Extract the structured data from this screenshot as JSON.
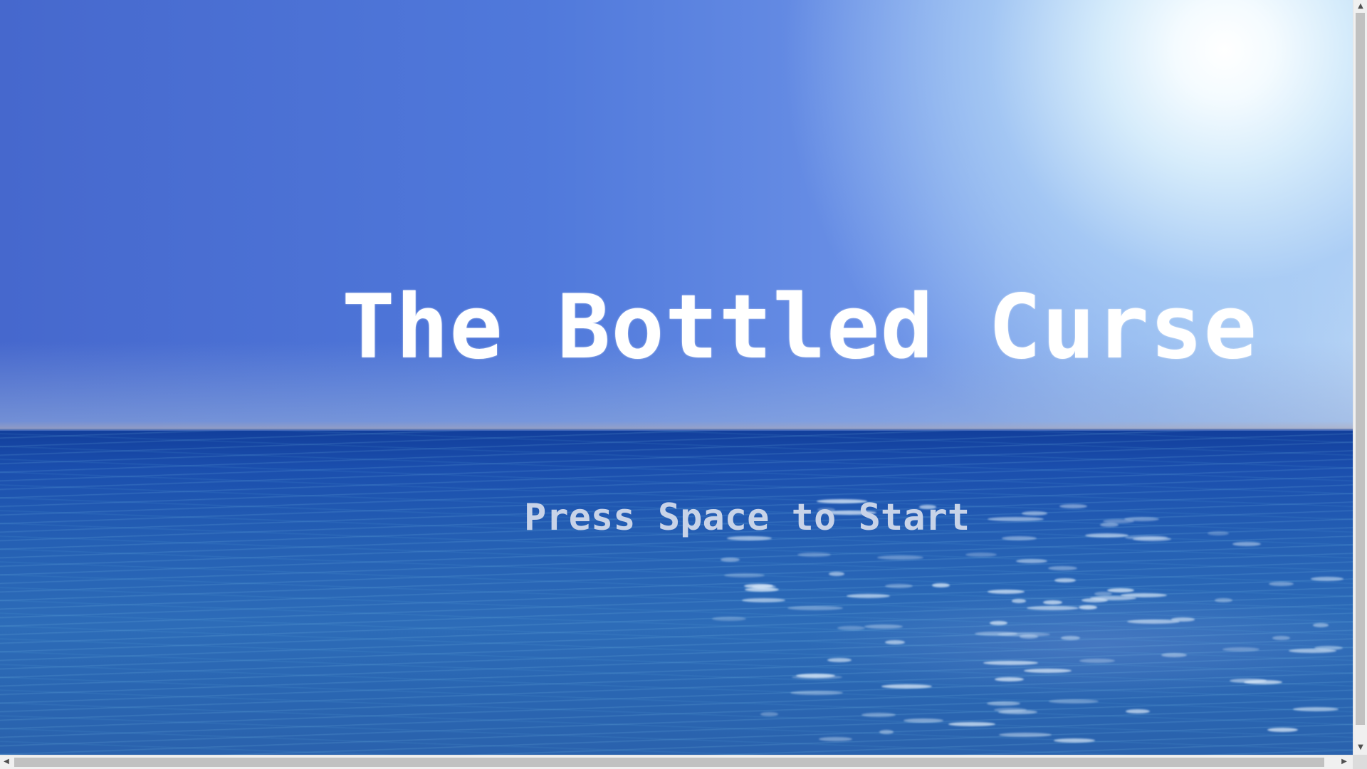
{
  "game": {
    "title": "The Bottled Curse",
    "start_prompt": "Press Space to Start"
  },
  "scene": {
    "sky_color": "#4a6ed2",
    "sun_color": "#ffffff",
    "sea_color": "#1f55b0",
    "title_color": "#ffffff",
    "prompt_color": "#c8d3e8"
  },
  "scrollbars": {
    "up_arrow": "▲",
    "down_arrow": "▼",
    "left_arrow": "◀",
    "right_arrow": "▶"
  }
}
